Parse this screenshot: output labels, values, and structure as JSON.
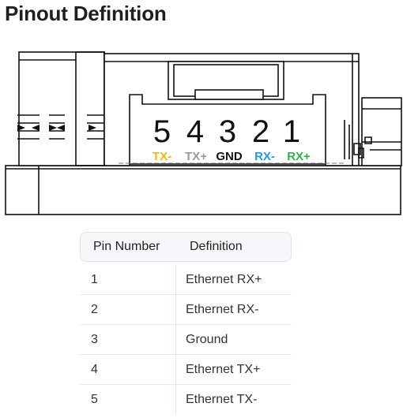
{
  "page": {
    "title": "Pinout Definition"
  },
  "diagram": {
    "pin_numbers": [
      "5",
      "4",
      "3",
      "2",
      "1"
    ],
    "pin_labels": [
      {
        "text": "TX-",
        "color": "#f5b800"
      },
      {
        "text": "TX+",
        "color": "#9a9a9a"
      },
      {
        "text": "GND",
        "color": "#111111"
      },
      {
        "text": "RX-",
        "color": "#1e9be8"
      },
      {
        "text": "RX+",
        "color": "#2fb34a"
      }
    ]
  },
  "table": {
    "headers": [
      "Pin Number",
      "Definition"
    ],
    "rows": [
      {
        "pin": "1",
        "definition": "Ethernet RX+"
      },
      {
        "pin": "2",
        "definition": "Ethernet RX-"
      },
      {
        "pin": "3",
        "definition": "Ground"
      },
      {
        "pin": "4",
        "definition": "Ethernet TX+"
      },
      {
        "pin": "5",
        "definition": "Ethernet TX-"
      }
    ]
  }
}
